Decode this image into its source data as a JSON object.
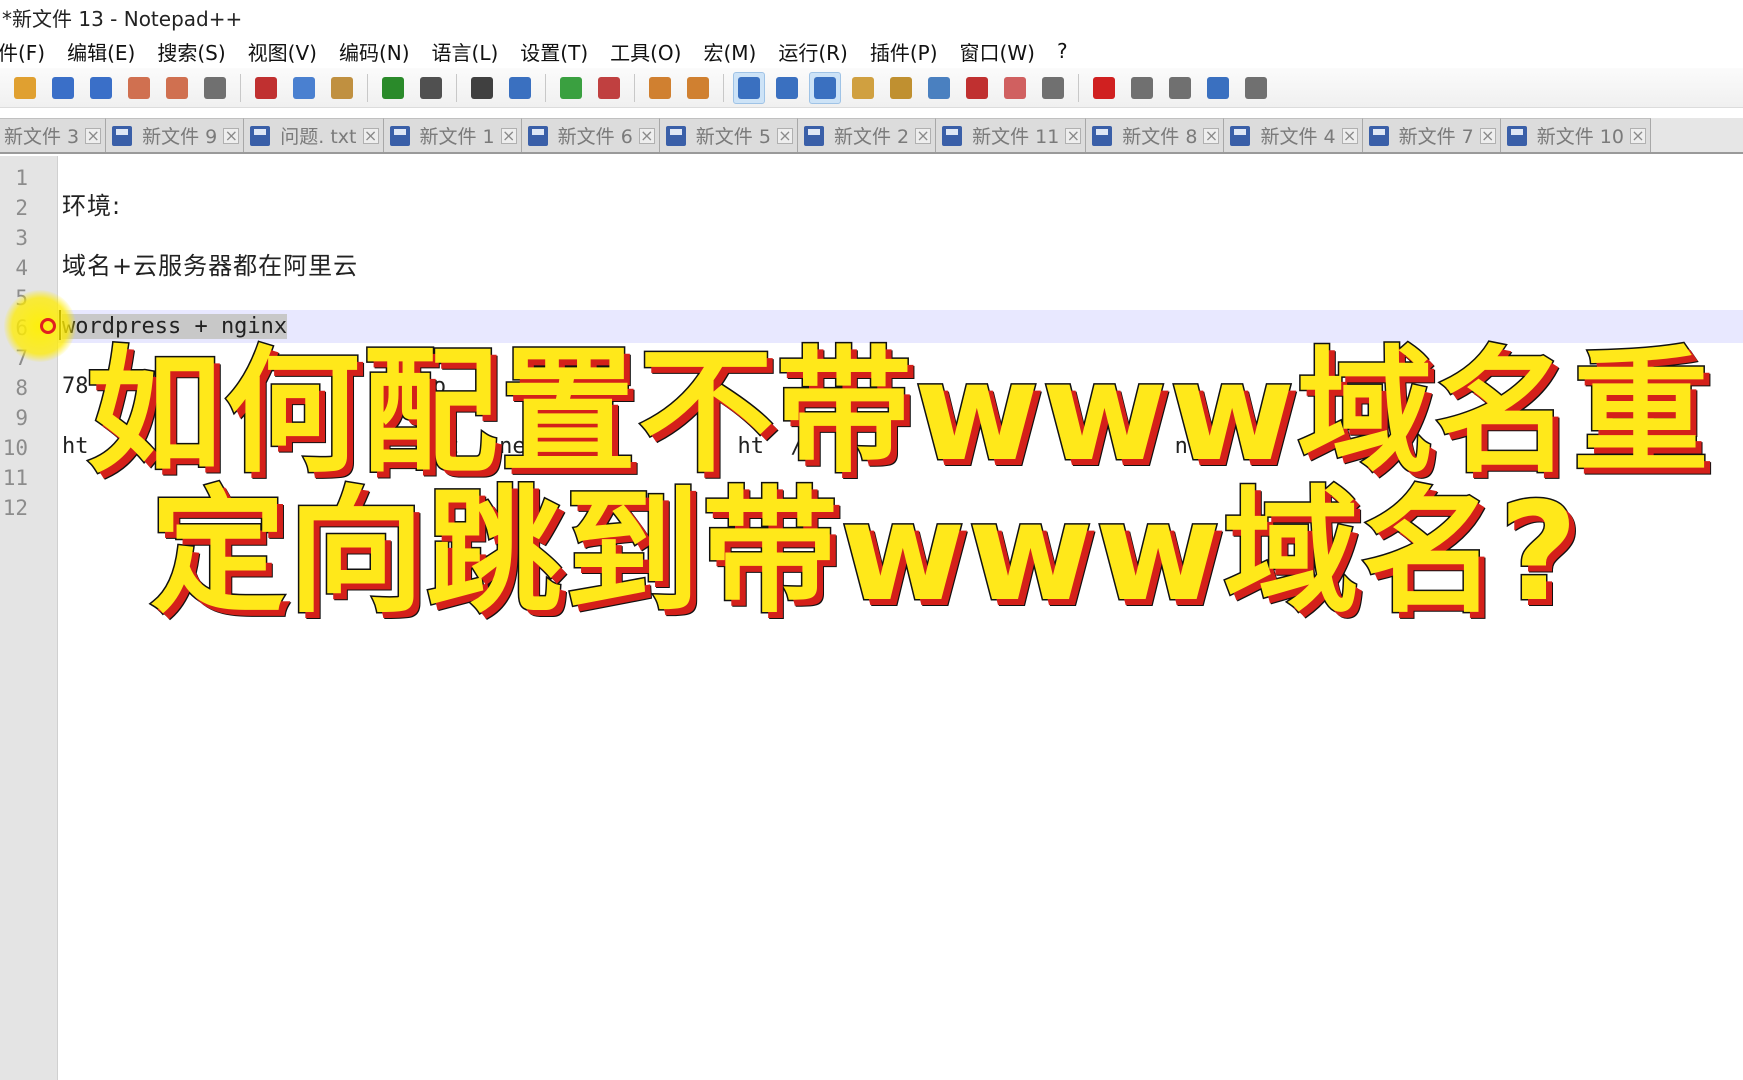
{
  "window": {
    "title": "*新文件 13 - Notepad++"
  },
  "menu": [
    "件(F)",
    "编辑(E)",
    "搜索(S)",
    "视图(V)",
    "编码(N)",
    "语言(L)",
    "设置(T)",
    "工具(O)",
    "宏(M)",
    "运行(R)",
    "插件(P)",
    "窗口(W)",
    "?"
  ],
  "toolbar": {
    "groups": [
      [
        {
          "icon": "open-file-icon",
          "color": "#e0a030"
        },
        {
          "icon": "save-icon",
          "color": "#3a6fc8"
        },
        {
          "icon": "save-all-icon",
          "color": "#3a6fc8"
        },
        {
          "icon": "close-file-icon",
          "color": "#d07050"
        },
        {
          "icon": "close-all-icon",
          "color": "#d07050"
        },
        {
          "icon": "print-icon",
          "color": "#707070"
        }
      ],
      [
        {
          "icon": "cut-icon",
          "color": "#c03030"
        },
        {
          "icon": "copy-icon",
          "color": "#4a80d0"
        },
        {
          "icon": "paste-icon",
          "color": "#c09040"
        }
      ],
      [
        {
          "icon": "undo-icon",
          "color": "#2a8a2a"
        },
        {
          "icon": "redo-icon",
          "color": "#505050"
        }
      ],
      [
        {
          "icon": "find-icon",
          "color": "#404040"
        },
        {
          "icon": "replace-icon",
          "color": "#3a70c0"
        }
      ],
      [
        {
          "icon": "zoom-in-icon",
          "color": "#3aa040"
        },
        {
          "icon": "zoom-out-icon",
          "color": "#c04040"
        }
      ],
      [
        {
          "icon": "sync-vertical-icon",
          "color": "#d08030"
        },
        {
          "icon": "sync-horizontal-icon",
          "color": "#d08030"
        }
      ],
      [
        {
          "icon": "word-wrap-icon",
          "color": "#3a70c0",
          "active": true
        },
        {
          "icon": "show-all-chars-icon",
          "color": "#3a70c0"
        },
        {
          "icon": "indent-guide-icon",
          "color": "#3a70c0",
          "active": true
        },
        {
          "icon": "udl-icon",
          "color": "#d0a040"
        },
        {
          "icon": "doc-map-icon",
          "color": "#c09030"
        },
        {
          "icon": "function-list-icon",
          "color": "#4a80c0"
        },
        {
          "icon": "folder-workspace-icon",
          "color": "#c03030"
        },
        {
          "icon": "monitoring-icon",
          "color": "#d06060"
        },
        {
          "icon": "doc-switcher-icon",
          "color": "#707070"
        }
      ],
      [
        {
          "icon": "record-macro-icon",
          "color": "#d02020"
        },
        {
          "icon": "stop-macro-icon",
          "color": "#707070"
        },
        {
          "icon": "play-macro-icon",
          "color": "#707070"
        },
        {
          "icon": "run-macro-multiple-icon",
          "color": "#3a70c0"
        },
        {
          "icon": "save-macro-icon",
          "color": "#707070"
        }
      ]
    ]
  },
  "tabs": [
    {
      "label": "新文件 3"
    },
    {
      "label": "新文件 9"
    },
    {
      "label": "问题. txt"
    },
    {
      "label": "新文件 1"
    },
    {
      "label": "新文件 6"
    },
    {
      "label": "新文件 5"
    },
    {
      "label": "新文件 2"
    },
    {
      "label": "新文件 11"
    },
    {
      "label": "新文件 8"
    },
    {
      "label": "新文件 4"
    },
    {
      "label": "新文件 7"
    },
    {
      "label": "新文件 10"
    }
  ],
  "tab_close_glyph": "×",
  "editor": {
    "line_numbers": [
      "1",
      "2",
      "3",
      "4",
      "5",
      "6",
      "7",
      "8",
      "9",
      "10",
      "11",
      "12"
    ],
    "lines": [
      {
        "n": 2,
        "text": "环境:"
      },
      {
        "n": 4,
        "text": "域名+云服务器都在阿里云"
      },
      {
        "n": 6,
        "text": "wordpress + nginx",
        "selected": true
      },
      {
        "n": 8,
        "text": "78                         co"
      },
      {
        "n": 10,
        "text": "ht                         nut  nnew               ht  /                            nute"
      }
    ],
    "current_line": 6
  },
  "overlay": {
    "line1": "如何配置不带www域名重",
    "line2": "定向跳到带www域名?"
  }
}
